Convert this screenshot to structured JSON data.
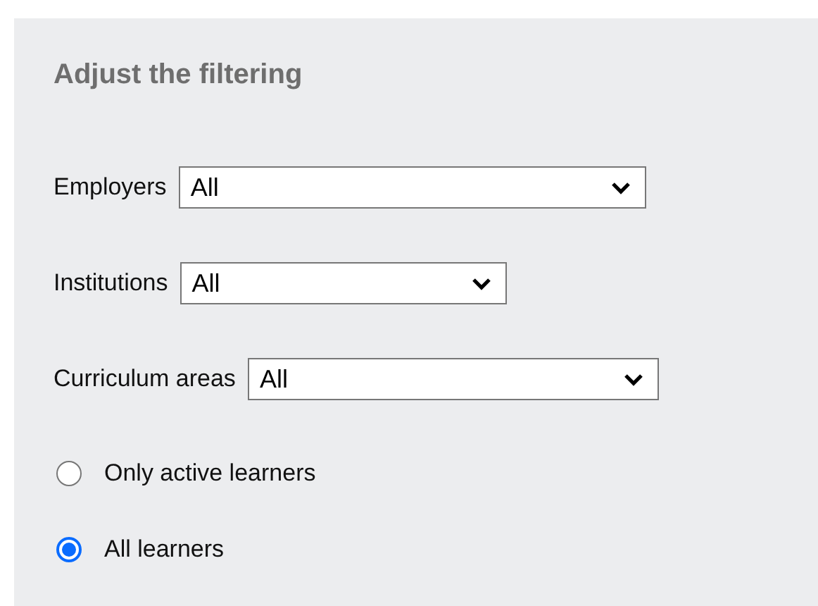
{
  "panel": {
    "title": "Adjust the filtering"
  },
  "filters": [
    {
      "label": "Employers",
      "value": "All"
    },
    {
      "label": "Institutions",
      "value": "All"
    },
    {
      "label": "Curriculum areas",
      "value": "All"
    }
  ],
  "learner_options": [
    {
      "label": "Only active learners",
      "selected": false
    },
    {
      "label": "All learners",
      "selected": true
    }
  ]
}
